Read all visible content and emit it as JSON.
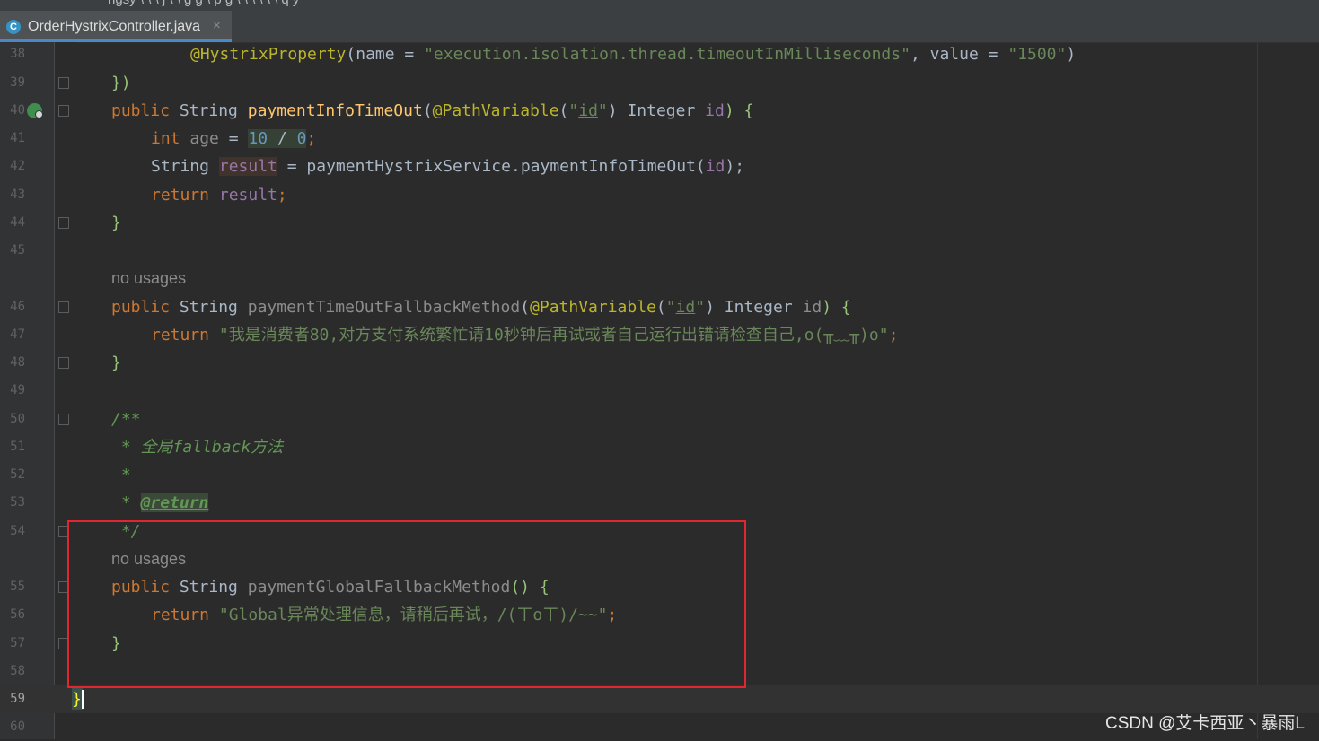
{
  "window": {
    "breadcrumbs": "ngsy   \\   \\   \\   j   \\   \\ g g   \\ p  g   \\   \\   \\   \\   \\   \\ q y"
  },
  "tabs": [
    {
      "title": "OrderHystrixController.java",
      "icon": "java-class-icon",
      "close": "×"
    }
  ],
  "editor": {
    "line_numbers": [
      "38",
      "39",
      "40",
      "41",
      "42",
      "43",
      "44",
      "45",
      "46",
      "47",
      "48",
      "49",
      "50",
      "51",
      "52",
      "53",
      "54",
      "55",
      "56",
      "57",
      "58",
      "59",
      "60"
    ],
    "current_line": "59",
    "usage_hints": [
      "no usages",
      "no usages"
    ],
    "code": {
      "l38_ann": "@HystrixProperty",
      "l38_a": "(name = ",
      "l38_s1": "\"execution.isolation.thread.timeoutInMilliseconds\"",
      "l38_b": ", value = ",
      "l38_s2": "\"1500\"",
      "l38_c": ")",
      "l39": "})",
      "l40_kw": "public",
      "l40_a": " String ",
      "l40_fn": "paymentInfoTimeOut",
      "l40_b": "(",
      "l40_ann": "@PathVariable",
      "l40_c": "(",
      "l40_s1": "\"",
      "l40_id": "id",
      "l40_s2": "\"",
      "l40_d": ") Integer ",
      "l40_p": "id",
      "l40_e": ") {",
      "l41_kw": "int",
      "l41_var": " age ",
      "l41_eq": "= ",
      "l41_n1": "10",
      "l41_op": " / ",
      "l41_n2": "0",
      "l41_semi": ";",
      "l42_type": "String ",
      "l42_var": "result",
      "l42_a": " = paymentHystrixService.paymentInfoTimeOut(",
      "l42_p": "id",
      "l42_b": ");",
      "l43_kw": "return ",
      "l43_var": "result",
      "l43_semi": ";",
      "l44": "}",
      "l46_kw": "public",
      "l46_a": " String ",
      "l46_fn": "paymentTimeOutFallbackMethod",
      "l46_b": "(",
      "l46_ann": "@PathVariable",
      "l46_c": "(",
      "l46_s1": "\"",
      "l46_id": "id",
      "l46_s2": "\"",
      "l46_d": ") Integer ",
      "l46_p": "id",
      "l46_e": ") {",
      "l47_kw": "return ",
      "l47_str": "\"我是消费者80,对方支付系统繁忙请10秒钟后再试或者自己运行出错请检查自己,o(╥﹏╥)o\"",
      "l47_semi": ";",
      "l48": "}",
      "l50": "/**",
      "l51": " * 全局fallback方法",
      "l52": " *",
      "l53_a": " * ",
      "l53_tag": "@return",
      "l54": " */",
      "l55_kw": "public",
      "l55_a": " String ",
      "l55_fn": "paymentGlobalFallbackMethod",
      "l55_b": "() {",
      "l56_kw": "return ",
      "l56_str": "\"Global异常处理信息，请稍后再试，/(ㄒoㄒ)/~~\"",
      "l56_semi": ";",
      "l57": "}",
      "l59": "}"
    }
  },
  "watermark": "CSDN @艾卡西亚丶暴雨L",
  "colors": {
    "background": "#2b2b2b",
    "keyword": "#cc7832",
    "annotation": "#bbb529",
    "string": "#6a8759",
    "method": "#ffc66d",
    "highlight_box": "#e0262f"
  }
}
